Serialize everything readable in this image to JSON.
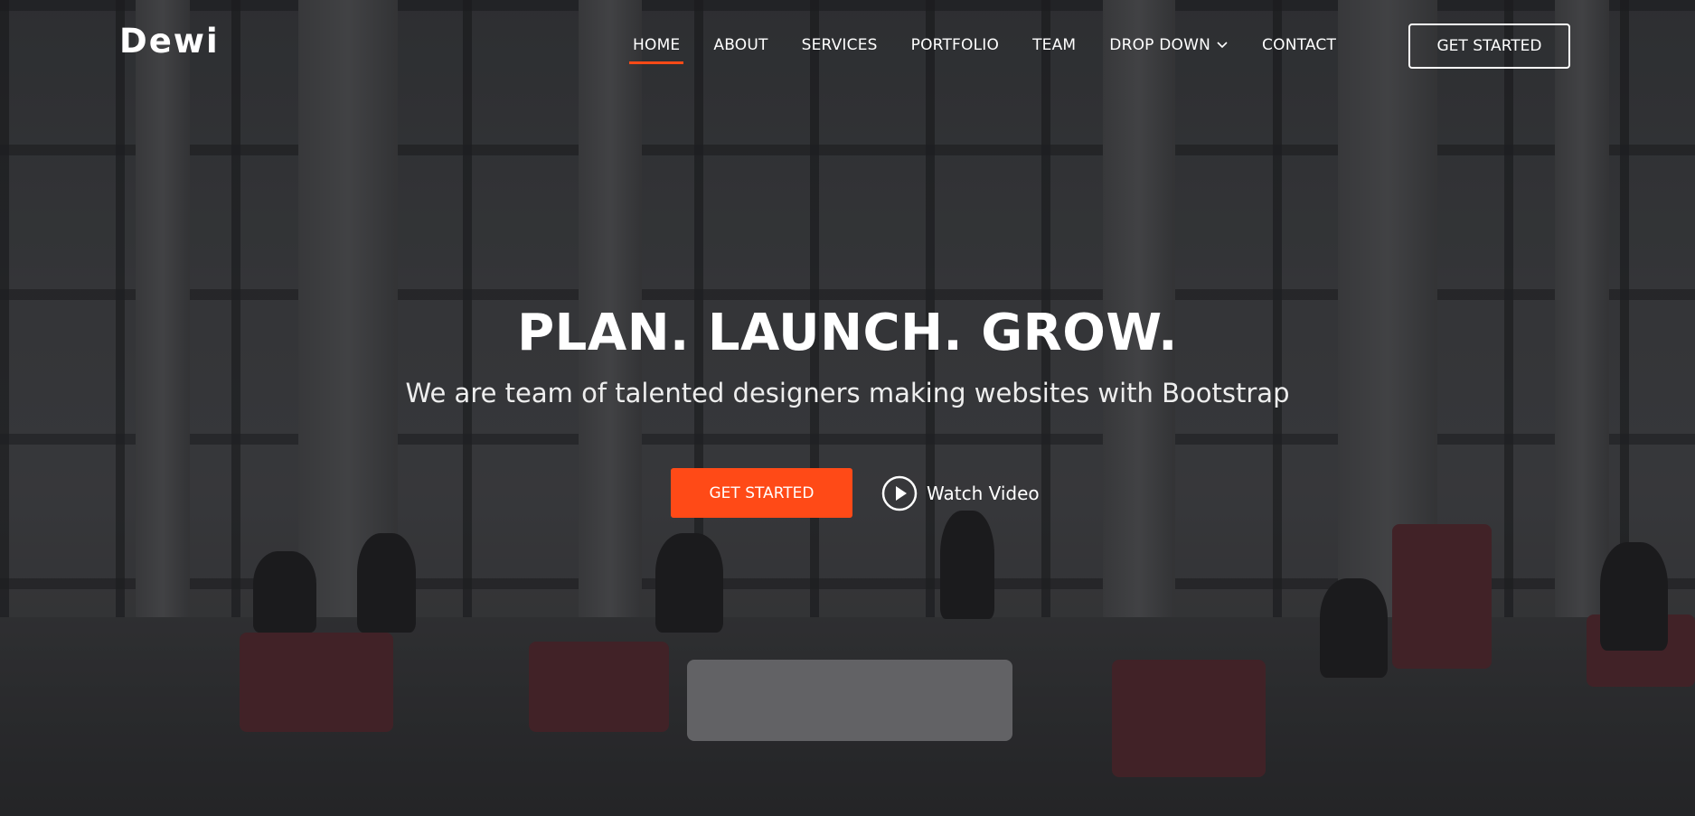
{
  "brand": {
    "logo": "Dewi"
  },
  "nav": {
    "items": [
      {
        "label": "HOME",
        "active": true
      },
      {
        "label": "ABOUT",
        "active": false
      },
      {
        "label": "SERVICES",
        "active": false
      },
      {
        "label": "PORTFOLIO",
        "active": false
      },
      {
        "label": "TEAM",
        "active": false
      },
      {
        "label": "DROP DOWN",
        "active": false,
        "icon": "chevron-down-icon"
      },
      {
        "label": "CONTACT",
        "active": false
      }
    ],
    "cta_label": "GET STARTED"
  },
  "hero": {
    "title": "PLAN. LAUNCH. GROW.",
    "subtitle": "We are team of talented designers making websites with Bootstrap",
    "cta_label": "GET STARTED",
    "video_label": "Watch Video",
    "video_icon": "play-circle-icon",
    "background": "lobby-photo"
  },
  "colors": {
    "accent": "#ff4a17",
    "text": "#ffffff"
  }
}
